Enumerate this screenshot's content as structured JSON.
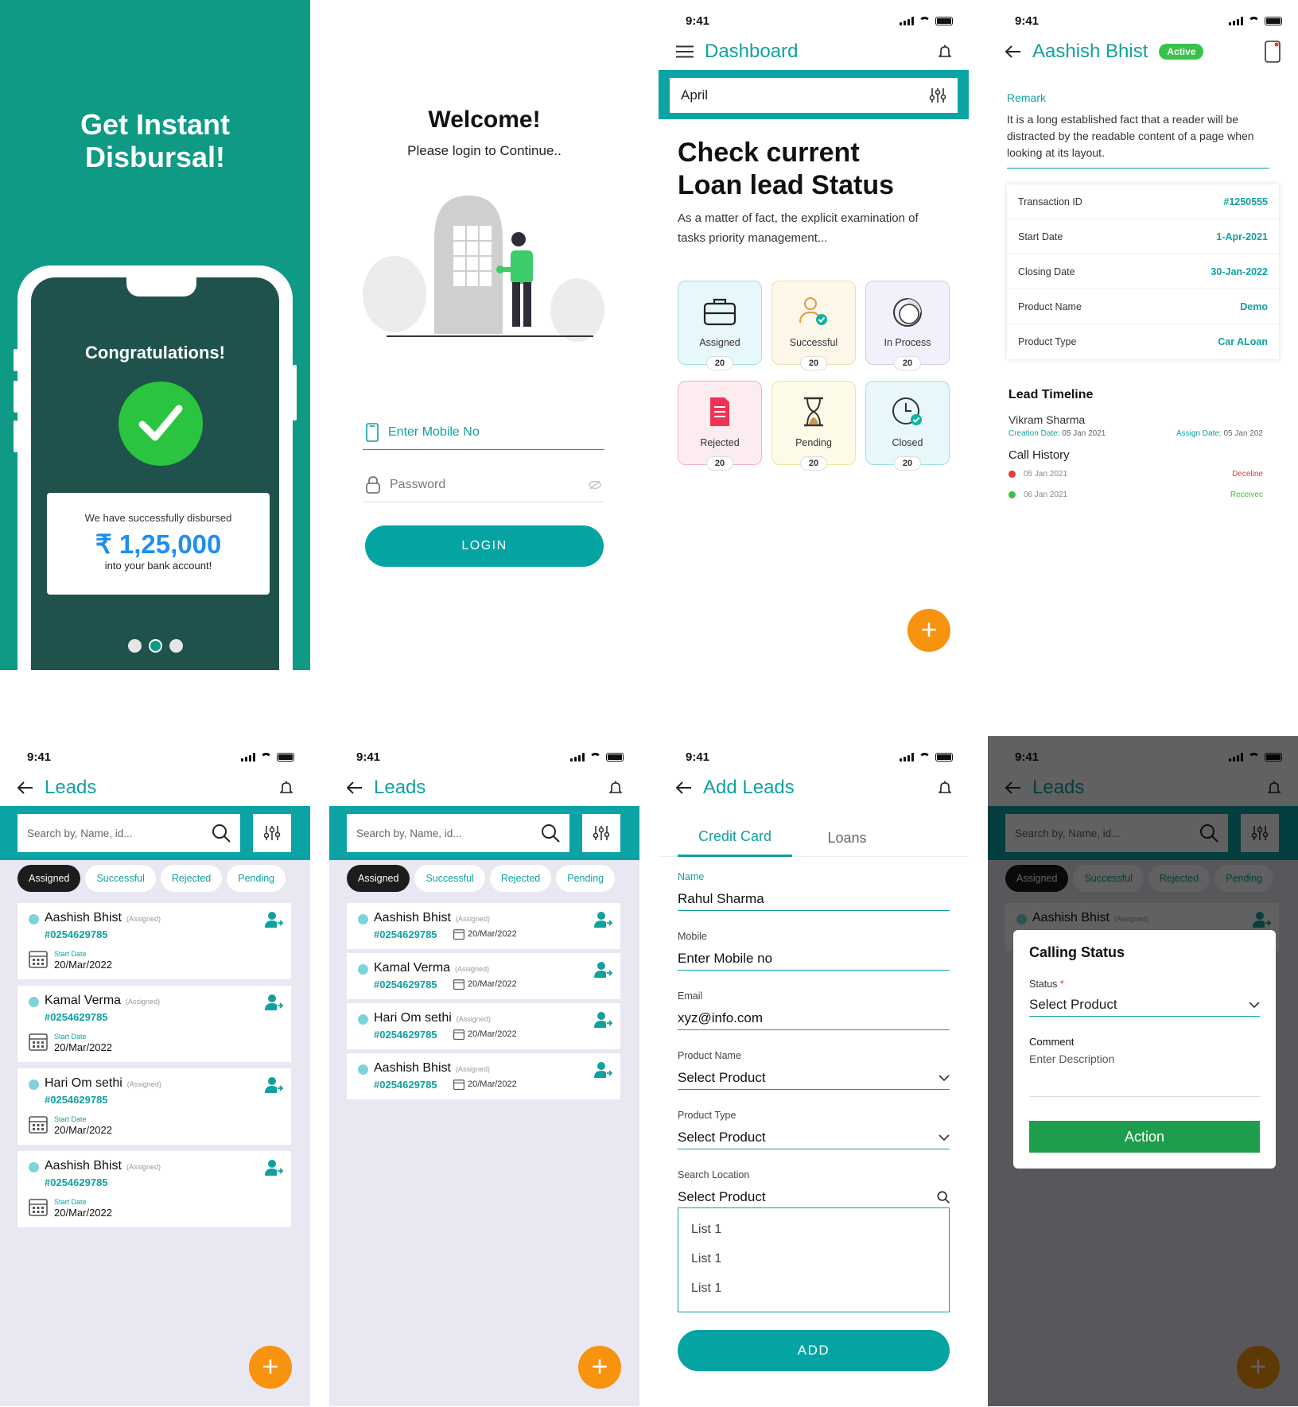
{
  "status_time": "9:41",
  "splash": {
    "title_line1": "Get Instant",
    "title_line2": "Disbursal!",
    "congrats": "Congratulations!",
    "line1": "We have successfully disbursed",
    "amount": "₹ 1,25,000",
    "line2": "into your bank account!",
    "active_dot_index": 1
  },
  "login": {
    "title": "Welcome!",
    "subtitle": "Please login to Continue..",
    "mobile_placeholder": "Enter Mobile No",
    "password_placeholder": "Password",
    "button": "LOGIN"
  },
  "dashboard": {
    "title": "Dashboard",
    "month": "April",
    "heading_line1": "Check current",
    "heading_line2": "Loan lead Status",
    "description": "As a matter of fact, the explicit examination of tasks priority management...",
    "tiles": [
      {
        "label": "Assigned",
        "count": "20",
        "icon": "briefcase-icon",
        "bg": "#e8f7fa",
        "border": "#9fdfe6"
      },
      {
        "label": "Successful",
        "count": "20",
        "icon": "user-check-icon",
        "bg": "#fdf7ea",
        "border": "#f4dca6"
      },
      {
        "label": "In Process",
        "count": "20",
        "icon": "pie-icon",
        "bg": "#f2f1fb",
        "border": "#cfcbee"
      },
      {
        "label": "Rejected",
        "count": "20",
        "icon": "document-icon",
        "bg": "#fdecef",
        "border": "#f3b4bf"
      },
      {
        "label": "Pending",
        "count": "20",
        "icon": "hourglass-icon",
        "bg": "#fdfbe7",
        "border": "#efe49a"
      },
      {
        "label": "Closed",
        "count": "20",
        "icon": "clock-check-icon",
        "bg": "#e8f7fa",
        "border": "#9fdfe6"
      }
    ]
  },
  "detail": {
    "name": "Aashish Bhist",
    "badge": "Active",
    "remark_label": "Remark",
    "remark": "It is a long established fact that a reader will be distracted by the readable content of a page when looking at its layout.",
    "rows": [
      {
        "label": "Transaction ID",
        "value": "#1250555"
      },
      {
        "label": "Start Date",
        "value": "1-Apr-2021"
      },
      {
        "label": "Closing Date",
        "value": "30-Jan-2022"
      },
      {
        "label": "Product Name",
        "value": "Demo"
      },
      {
        "label": "Product Type",
        "value": "Car ALoan"
      }
    ],
    "timeline_title": "Lead Timeline",
    "timeline_name": "Vikram Sharma",
    "creation_label": "Creation Date:",
    "creation_date": "05 Jan 2021",
    "assign_label": "Assign Date:",
    "assign_date": "05 Jan 202",
    "call_history_title": "Call History",
    "calls": [
      {
        "date": "05 Jan 2021",
        "status": "Deceline",
        "color": "#e53935"
      },
      {
        "date": "06 Jan 2021",
        "status": "Receivec",
        "color": "#3cc23c"
      }
    ]
  },
  "leads": {
    "title": "Leads",
    "search_placeholder": "Search by, Name, id...",
    "filters": [
      "Assigned",
      "Successful",
      "Rejected",
      "Pending"
    ],
    "start_date_label": "Start Date",
    "items": [
      {
        "name": "Aashish Bhist",
        "tag": "(Assigned)",
        "id": "#0254629785",
        "date": "20/Mar/2022"
      },
      {
        "name": "Kamal Verma",
        "tag": "(Assigned)",
        "id": "#0254629785",
        "date": "20/Mar/2022"
      },
      {
        "name": "Hari Om sethi",
        "tag": "(Assigned)",
        "id": "#0254629785",
        "date": "20/Mar/2022"
      },
      {
        "name": "Aashish Bhist",
        "tag": "(Assigned)",
        "id": "#0254629785",
        "date": "20/Mar/2022"
      }
    ]
  },
  "add_leads": {
    "title": "Add Leads",
    "tabs": [
      "Credit Card",
      "Loans"
    ],
    "name_label": "Name",
    "name_value": "Rahul Sharma",
    "mobile_label": "Mobile",
    "mobile_placeholder": "Enter Mobile no",
    "email_label": "Email",
    "email_value": "xyz@info.com",
    "product_name_label": "Product Name",
    "product_name_value": "Select Product",
    "product_type_label": "Product Type",
    "product_type_value": "Select Product",
    "location_label": "Search Location",
    "location_value": "Select Product",
    "list_items": [
      "List 1",
      "List 1",
      "List 1"
    ],
    "button": "ADD"
  },
  "calling_status": {
    "title": "Calling Status",
    "status_label": "Status",
    "required_mark": "*",
    "status_value": "Select Product",
    "comment_label": "Comment",
    "comment_placeholder": "Enter Description",
    "button": "Action"
  }
}
